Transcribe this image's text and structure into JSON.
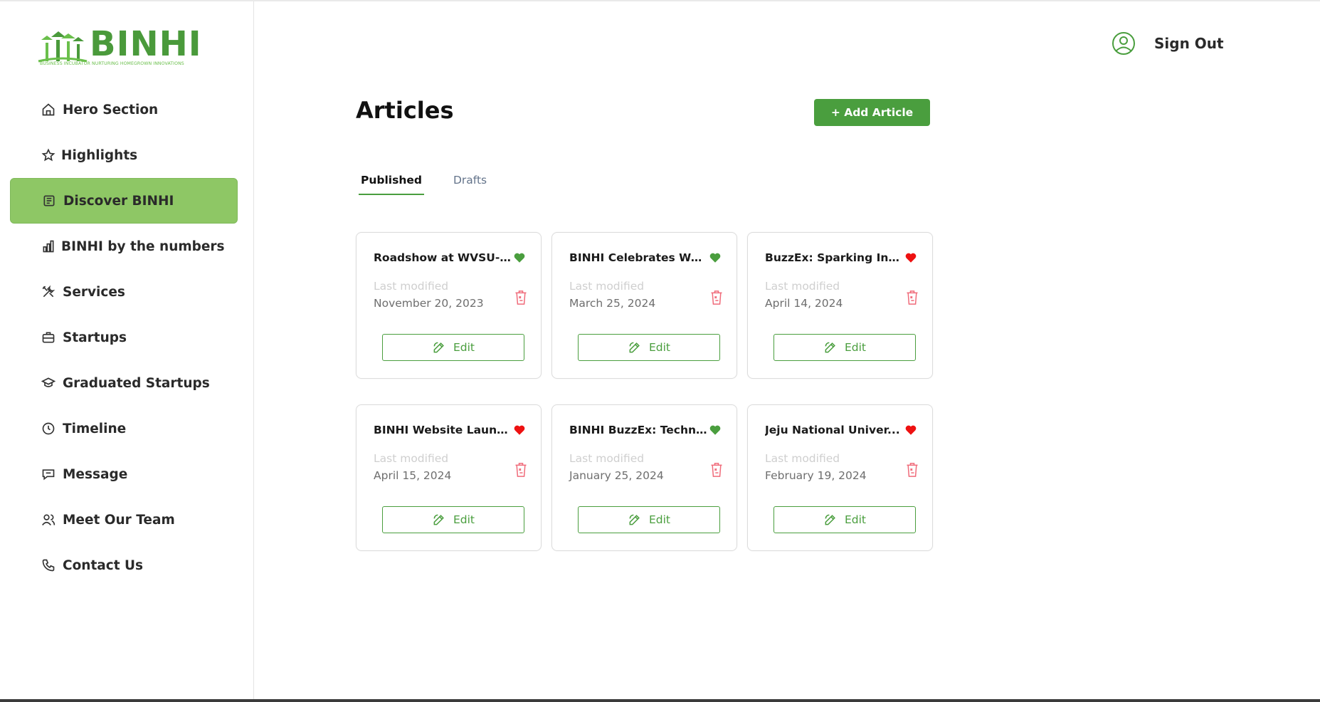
{
  "brand": {
    "name": "BINHI",
    "tagline": "BUSINESS INCUBATOR NURTURING HOMEGROWN INNOVATIONS",
    "accent_color": "#4a9e3e",
    "active_nav_color": "#8ec765"
  },
  "sidebar": {
    "items": [
      {
        "label": "Hero Section",
        "icon": "home-icon"
      },
      {
        "label": "Highlights",
        "icon": "star-icon"
      },
      {
        "label": "Discover BINHI",
        "icon": "newspaper-icon",
        "active": true
      },
      {
        "label": "BINHI by the numbers",
        "icon": "bar-chart-icon"
      },
      {
        "label": "Services",
        "icon": "tools-icon"
      },
      {
        "label": "Startups",
        "icon": "briefcase-icon"
      },
      {
        "label": "Graduated Startups",
        "icon": "graduation-cap-icon"
      },
      {
        "label": "Timeline",
        "icon": "clock-icon"
      },
      {
        "label": "Message",
        "icon": "message-icon"
      },
      {
        "label": "Meet Our Team",
        "icon": "users-icon"
      },
      {
        "label": "Contact Us",
        "icon": "phone-icon"
      }
    ]
  },
  "header": {
    "signout_label": "Sign Out",
    "user_icon": "user-circle-icon"
  },
  "main": {
    "title": "Articles",
    "add_button_label": "+ Add Article",
    "tabs": [
      {
        "label": "Published",
        "active": true
      },
      {
        "label": "Drafts",
        "active": false
      }
    ],
    "last_modified_label": "Last modified",
    "edit_label": "Edit",
    "articles": [
      {
        "title": "Roadshow at WVSU-Cal...",
        "date": "November 20, 2023",
        "heart_color": "#4a9e3e"
      },
      {
        "title": "BINHI Celebrates Wom...",
        "date": "March 25, 2024",
        "heart_color": "#4a9e3e"
      },
      {
        "title": "BuzzEx: Sparking Inn...",
        "date": "April 14, 2024",
        "heart_color": "#ee1111"
      },
      {
        "title": "BINHI Website Launch...",
        "date": "April 15, 2024",
        "heart_color": "#ee1111"
      },
      {
        "title": "BINHI BuzzEx: Techno...",
        "date": "January 25, 2024",
        "heart_color": "#4a9e3e"
      },
      {
        "title": "Jeju National Univer...",
        "date": "February 19, 2024",
        "heart_color": "#ee1111"
      }
    ]
  }
}
